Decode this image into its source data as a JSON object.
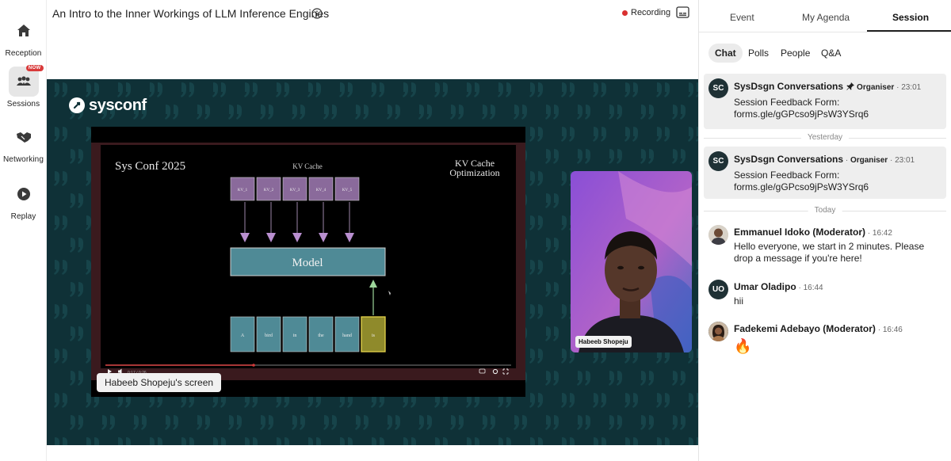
{
  "nav": {
    "items": [
      {
        "label": "Reception",
        "icon": "home-icon"
      },
      {
        "label": "Sessions",
        "icon": "audience-icon",
        "badge": "NOW",
        "active": true
      },
      {
        "label": "Networking",
        "icon": "handshake-icon"
      },
      {
        "label": "Replay",
        "icon": "play-circle-icon"
      }
    ]
  },
  "session": {
    "title": "An Intro to the Inner Workings of LLM Inference Engines",
    "recording_label": "Recording",
    "recording_color": "#d93030"
  },
  "stage": {
    "brand": "sysconf",
    "background_color": "#0f3137",
    "screen_label": "Habeeb Shopeju's screen",
    "camera_name": "Habeeb Shopeju"
  },
  "slide": {
    "left_title": "Sys Conf 2025",
    "cache_title": "KV Cache",
    "right_title_line1": "KV Cache",
    "right_title_line2": "Optimization",
    "kv_boxes": [
      "KV_1",
      "KV_2",
      "KV_3",
      "KV_4",
      "KV_5"
    ],
    "model_label": "Model",
    "tokens": [
      "A",
      "bird",
      "in",
      "the",
      "hand",
      "is"
    ],
    "player_time": "0:17 / 0:26"
  },
  "panel": {
    "tabs": [
      "Event",
      "My Agenda",
      "Session"
    ],
    "active_tab": "Session",
    "subtabs": [
      "Chat",
      "Polls",
      "People",
      "Q&A"
    ],
    "active_subtab": "Chat"
  },
  "chat": {
    "messages": [
      {
        "initials": "SC",
        "name": "SysDsgn Conversations",
        "pinned": true,
        "role": "Organiser",
        "time": "23:01",
        "lines": [
          "Session Feedback Form:",
          "forms.gle/gGPcso9jPsW3YSrq6"
        ]
      },
      {
        "divider": "Yesterday"
      },
      {
        "initials": "SC",
        "name": "SysDsgn Conversations",
        "role": "Organiser",
        "time": "23:01",
        "lines": [
          "Session Feedback Form:",
          "forms.gle/gGPcso9jPsW3YSrq6"
        ]
      },
      {
        "divider": "Today"
      },
      {
        "name": "Emmanuel Idoko (Moderator)",
        "time": "16:42",
        "lines": [
          "Hello everyone, we start in 2 minutes. Please",
          "drop a message if you're here!"
        ]
      },
      {
        "initials": "UO",
        "name": "Umar Oladipo",
        "time": "16:44",
        "lines": [
          "hii"
        ]
      },
      {
        "name": "Fadekemi Adebayo (Moderator)",
        "time": "16:46",
        "emoji": "🔥"
      }
    ]
  }
}
